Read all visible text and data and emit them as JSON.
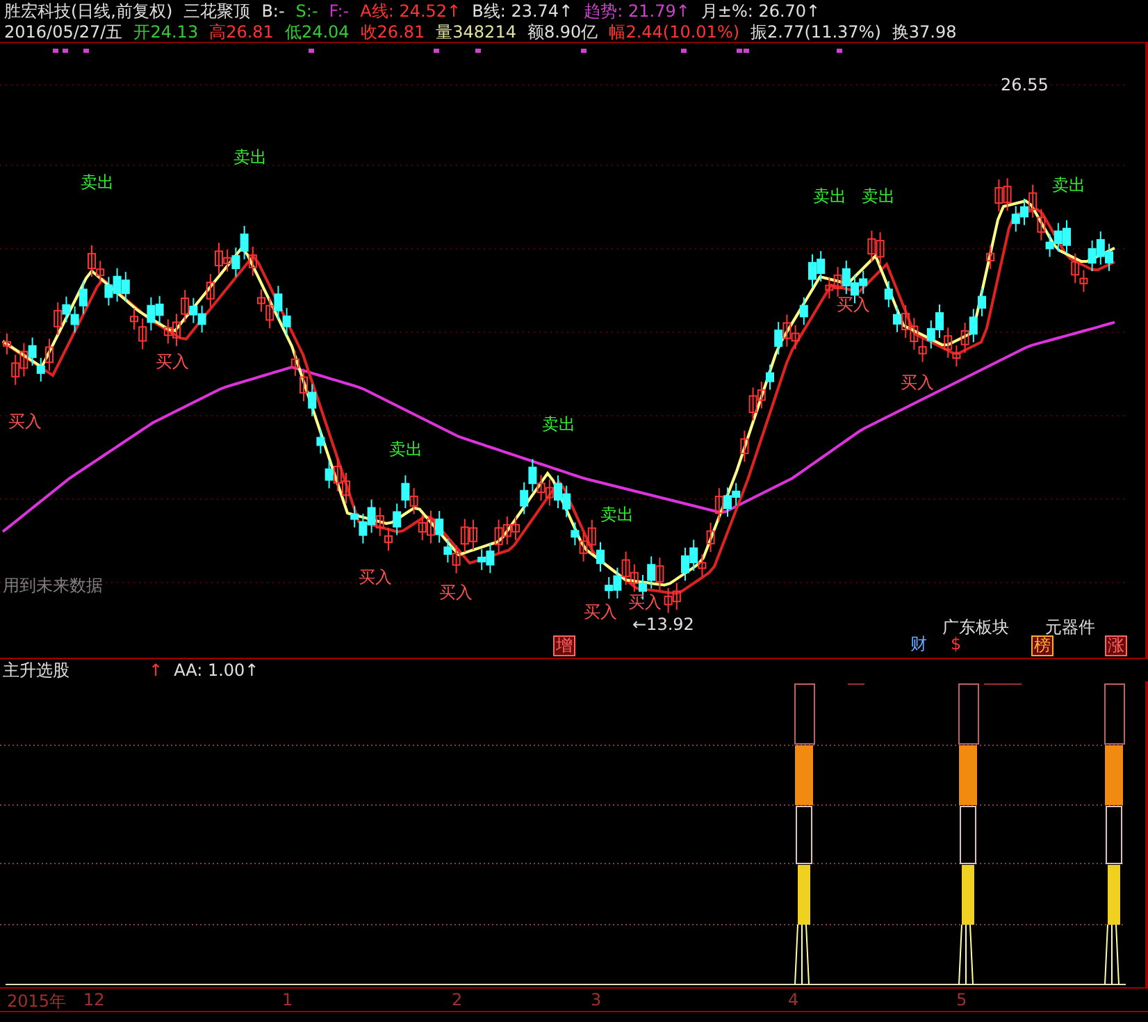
{
  "header": {
    "title": "胜宏科技(日线,前复权)",
    "formula": "三花聚顶",
    "fields": [
      {
        "text": "B:-",
        "color": "#e0e0e0"
      },
      {
        "text": "S:-",
        "color": "#33cc33"
      },
      {
        "text": "F:-",
        "color": "#cc33cc"
      },
      {
        "text": "A线: 24.52↑",
        "color": "#ff3333"
      },
      {
        "text": "B线: 23.74↑",
        "color": "#e0e0e0"
      },
      {
        "text": "趋势: 21.79↑",
        "color": "#cc44cc"
      },
      {
        "text": "月±%: 26.70↑",
        "color": "#e0e0e0"
      }
    ],
    "quote": [
      {
        "text": "2016/05/27/五",
        "color": "#e0e0e0"
      },
      {
        "text": "开24.13",
        "color": "#33cc33"
      },
      {
        "text": "高26.81",
        "color": "#ff3333"
      },
      {
        "text": "低24.04",
        "color": "#33cc33"
      },
      {
        "text": "收26.81",
        "color": "#ff3333"
      },
      {
        "text": "量348214",
        "color": "#e0e0a0"
      },
      {
        "text": "额8.90亿",
        "color": "#e0e0e0"
      },
      {
        "text": "幅2.44(10.01%)",
        "color": "#ff3333"
      },
      {
        "text": "振2.77(11.37%)",
        "color": "#e0e0e0"
      },
      {
        "text": "换37.98",
        "color": "#e0e0e0"
      }
    ]
  },
  "price_chart": {
    "high_label": "26.55",
    "low_label": "←13.92",
    "note": "用到未来数据",
    "signals": [
      {
        "text": "卖出",
        "kind": "sell"
      },
      {
        "text": "卖出",
        "kind": "sell"
      },
      {
        "text": "卖出",
        "kind": "sell"
      },
      {
        "text": "卖出",
        "kind": "sell"
      },
      {
        "text": "卖出",
        "kind": "sell"
      },
      {
        "text": "卖出",
        "kind": "sell"
      },
      {
        "text": "卖出",
        "kind": "sell"
      },
      {
        "text": "卖出",
        "kind": "sell"
      },
      {
        "text": "买入",
        "kind": "buy"
      },
      {
        "text": "买入",
        "kind": "buy"
      },
      {
        "text": "买入",
        "kind": "buy"
      },
      {
        "text": "买入",
        "kind": "buy"
      },
      {
        "text": "买入",
        "kind": "buy"
      },
      {
        "text": "买入",
        "kind": "buy"
      },
      {
        "text": "买入",
        "kind": "buy"
      },
      {
        "text": "买入",
        "kind": "buy"
      }
    ],
    "tags": [
      {
        "text": "增",
        "kind": "boxed",
        "color": "#ff6666"
      },
      {
        "text": "财",
        "kind": "plain",
        "color": "#66aaff"
      },
      {
        "text": "广东板块",
        "kind": "plain",
        "color": "#e0e0e0"
      },
      {
        "text": "$",
        "kind": "plain",
        "color": "#ff3333"
      },
      {
        "text": "榜",
        "kind": "boxed",
        "color": "#ffaa33"
      },
      {
        "text": "元器件",
        "kind": "plain",
        "color": "#e0e0e0"
      },
      {
        "text": "涨",
        "kind": "boxed",
        "color": "#ff6666"
      }
    ]
  },
  "indicator": {
    "name": "主升选股",
    "reading": "AA: 1.00↑",
    "arrow": "↑"
  },
  "time_axis": [
    "2015年",
    "12",
    "1",
    "2",
    "3",
    "4",
    "5"
  ]
}
